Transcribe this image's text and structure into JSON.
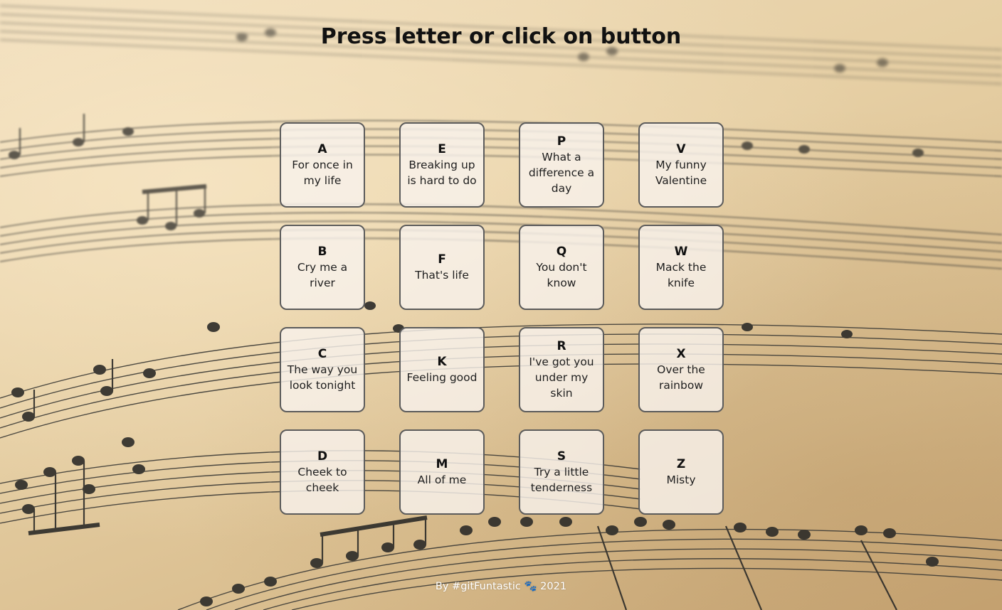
{
  "page": {
    "title": "Press letter or click on button"
  },
  "keys": [
    {
      "letter": "A",
      "song": "For once in my life"
    },
    {
      "letter": "E",
      "song": "Breaking up is hard to do"
    },
    {
      "letter": "P",
      "song": "What a difference a day"
    },
    {
      "letter": "V",
      "song": "My funny Valentine"
    },
    {
      "letter": "B",
      "song": "Cry me a river"
    },
    {
      "letter": "F",
      "song": "That's life"
    },
    {
      "letter": "Q",
      "song": "You don't know"
    },
    {
      "letter": "W",
      "song": "Mack the knife"
    },
    {
      "letter": "C",
      "song": "The way you look tonight"
    },
    {
      "letter": "K",
      "song": "Feeling good"
    },
    {
      "letter": "R",
      "song": "I've got you under my skin"
    },
    {
      "letter": "X",
      "song": "Over the rainbow"
    },
    {
      "letter": "D",
      "song": "Cheek to cheek"
    },
    {
      "letter": "M",
      "song": "All of me"
    },
    {
      "letter": "S",
      "song": "Try a little tenderness"
    },
    {
      "letter": "Z",
      "song": "Misty"
    }
  ],
  "footer": {
    "by": "By #gitFuntastic",
    "paw_glyph": "🐾",
    "year": "2021"
  },
  "colors": {
    "paw": "#f09a1a",
    "key_border": "#5b5b5b"
  },
  "background": {
    "icon": "sheet-music-background"
  }
}
